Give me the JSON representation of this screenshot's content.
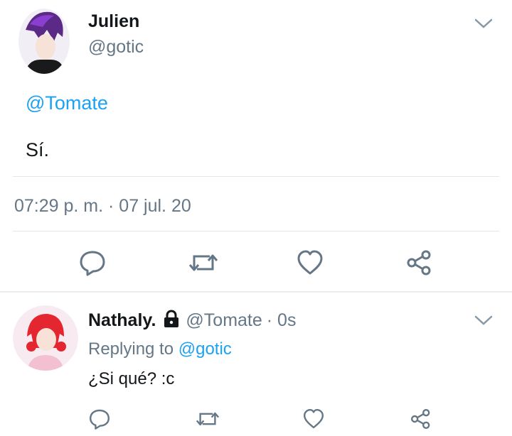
{
  "tweet": {
    "author_name": "Julien",
    "author_handle": "@gotic",
    "mention": "@Tomate",
    "text": "Sí.",
    "timestamp": "07:29 p. m. · 07 jul. 20"
  },
  "reply": {
    "author_name": "Nathaly.",
    "author_handle": "@Tomate",
    "time": "· 0s",
    "replying_prefix": "Replying to",
    "replying_handle": "@gotic",
    "text": "¿Si qué? :c"
  },
  "actions": [
    "reply-icon",
    "retweet-icon",
    "like-icon",
    "share-icon"
  ],
  "colors": {
    "accent": "#1da1f2",
    "secondary_text": "#657786",
    "icon": "#657786",
    "divider": "#e1e8ed"
  }
}
